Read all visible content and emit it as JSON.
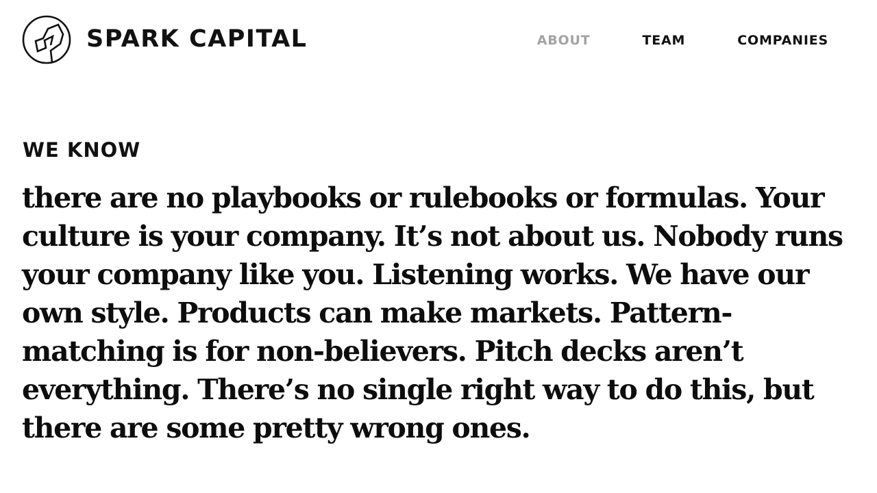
{
  "brand": {
    "name": "SPARK CAPITAL",
    "logo_icon": "spark-capital-logo-icon"
  },
  "nav": {
    "items": [
      {
        "label": "ABOUT",
        "active": true
      },
      {
        "label": "TEAM",
        "active": false
      },
      {
        "label": "COMPANIES",
        "active": false
      }
    ]
  },
  "hero": {
    "eyebrow": "WE KNOW",
    "statement": "there are no playbooks or rulebooks or formulas. Your culture is your company. It’s not about us. Nobody runs your company like you. Listening works. We have our own style. Products can make markets. Pattern-matching is for non-believers. Pitch decks aren’t everything. There’s no single right way to do this, but there are some pretty wrong ones."
  },
  "colors": {
    "text": "#111111",
    "nav_active": "#a3a3a3",
    "background": "#ffffff"
  }
}
